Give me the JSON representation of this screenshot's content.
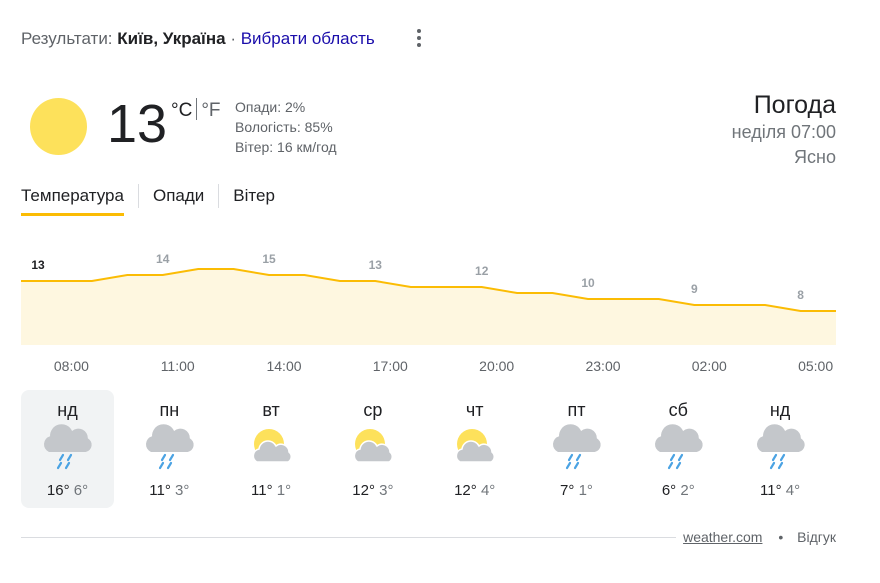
{
  "header": {
    "results_label": "Результати:",
    "location": "Київ, Україна",
    "separator": "·",
    "choose_region": "Вибрати область"
  },
  "current": {
    "temperature": "13",
    "unit_c": "°C",
    "unit_f": "°F",
    "precipitation": "Опади: 2%",
    "humidity": "Вологість: 85%",
    "wind": "Вітер: 16 км/год",
    "title": "Погода",
    "datetime": "неділя 07:00",
    "condition": "Ясно",
    "icon": "sun-icon",
    "sun_color": "#fde15b"
  },
  "tabs": [
    {
      "label": "Температура",
      "active": true
    },
    {
      "label": "Опади",
      "active": false
    },
    {
      "label": "Вітер",
      "active": false
    }
  ],
  "chart_data": {
    "type": "area",
    "line_color": "#fbbc04",
    "fill_color": "#fef7e0",
    "x": [
      "07:00",
      "08:00",
      "09:00",
      "10:00",
      "11:00",
      "12:00",
      "13:00",
      "14:00",
      "15:00",
      "16:00",
      "17:00",
      "18:00",
      "19:00",
      "20:00",
      "21:00",
      "22:00",
      "23:00",
      "00:00",
      "01:00",
      "02:00",
      "03:00",
      "04:00",
      "05:00",
      "06:00"
    ],
    "values": [
      13,
      13,
      13,
      14,
      14,
      15,
      15,
      14,
      14,
      13,
      13,
      12,
      12,
      12,
      11,
      11,
      10,
      10,
      10,
      9,
      9,
      9,
      8,
      8
    ],
    "labels": [
      {
        "x_index": 1,
        "text": "13",
        "highlight": true
      },
      {
        "x_index": 4,
        "text": "14"
      },
      {
        "x_index": 7,
        "text": "15"
      },
      {
        "x_index": 10,
        "text": "13"
      },
      {
        "x_index": 13,
        "text": "12"
      },
      {
        "x_index": 16,
        "text": "10"
      },
      {
        "x_index": 19,
        "text": "9"
      },
      {
        "x_index": 22,
        "text": "8"
      }
    ],
    "tick_labels": [
      "08:00",
      "11:00",
      "14:00",
      "17:00",
      "20:00",
      "23:00",
      "02:00",
      "05:00"
    ]
  },
  "days": [
    {
      "name": "нд",
      "icon": "rain-cloud-icon",
      "hi": "16°",
      "lo": "6°",
      "selected": true
    },
    {
      "name": "пн",
      "icon": "rain-cloud-icon",
      "hi": "11°",
      "lo": "3°",
      "selected": false
    },
    {
      "name": "вт",
      "icon": "partly-cloudy-icon",
      "hi": "11°",
      "lo": "1°",
      "selected": false
    },
    {
      "name": "ср",
      "icon": "partly-cloudy-icon",
      "hi": "12°",
      "lo": "3°",
      "selected": false
    },
    {
      "name": "чт",
      "icon": "partly-cloudy-icon",
      "hi": "12°",
      "lo": "4°",
      "selected": false
    },
    {
      "name": "пт",
      "icon": "rain-cloud-icon",
      "hi": "7°",
      "lo": "1°",
      "selected": false
    },
    {
      "name": "сб",
      "icon": "rain-cloud-icon",
      "hi": "6°",
      "lo": "2°",
      "selected": false
    },
    {
      "name": "нд",
      "icon": "rain-cloud-icon",
      "hi": "11°",
      "lo": "4°",
      "selected": false
    }
  ],
  "footer": {
    "source": "weather.com",
    "bullet": "•",
    "feedback": "Відгук"
  }
}
